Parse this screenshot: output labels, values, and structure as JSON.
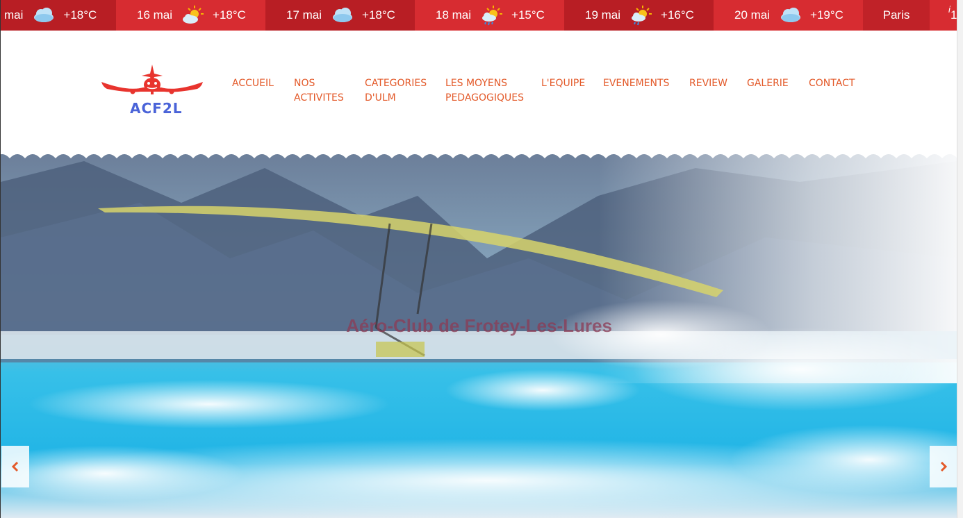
{
  "weather": {
    "days": [
      {
        "date": "mai",
        "icon": "cloud-icon",
        "temp": "+18°C"
      },
      {
        "date": "16 mai",
        "icon": "sun-cloud-icon",
        "temp": "+18°C"
      },
      {
        "date": "17 mai",
        "icon": "cloud-icon",
        "temp": "+18°C"
      },
      {
        "date": "18 mai",
        "icon": "sun-rain-icon",
        "temp": "+15°C"
      },
      {
        "date": "19 mai",
        "icon": "sun-rain-icon",
        "temp": "+16°C"
      },
      {
        "date": "20 mai",
        "icon": "cloud-icon",
        "temp": "+19°C"
      }
    ],
    "city": "Paris",
    "next": "1",
    "info": "i"
  },
  "brand": {
    "logo_text": "ACF2L",
    "accent": "#e8342e",
    "logo_text_color": "#4a63d8"
  },
  "nav": {
    "color": "#e35a2a",
    "items": [
      {
        "line1": "ACCUEIL",
        "line2": ""
      },
      {
        "line1": "NOS",
        "line2": "ACTIVITES"
      },
      {
        "line1": "CATEGORIES",
        "line2": "D'ULM"
      },
      {
        "line1": "LES MOYENS",
        "line2": "PEDAGOGIQUES"
      },
      {
        "line1": "L'EQUIPE",
        "line2": ""
      },
      {
        "line1": "EVENEMENTS",
        "line2": ""
      },
      {
        "line1": "REVIEW",
        "line2": ""
      },
      {
        "line1": "GALERIE",
        "line2": ""
      },
      {
        "line1": "CONTACT",
        "line2": ""
      }
    ]
  },
  "hero": {
    "title": "Aéro-Club de Frotey-Les-Lures",
    "prev_icon": "chevron-left-icon",
    "next_icon": "chevron-right-icon"
  }
}
